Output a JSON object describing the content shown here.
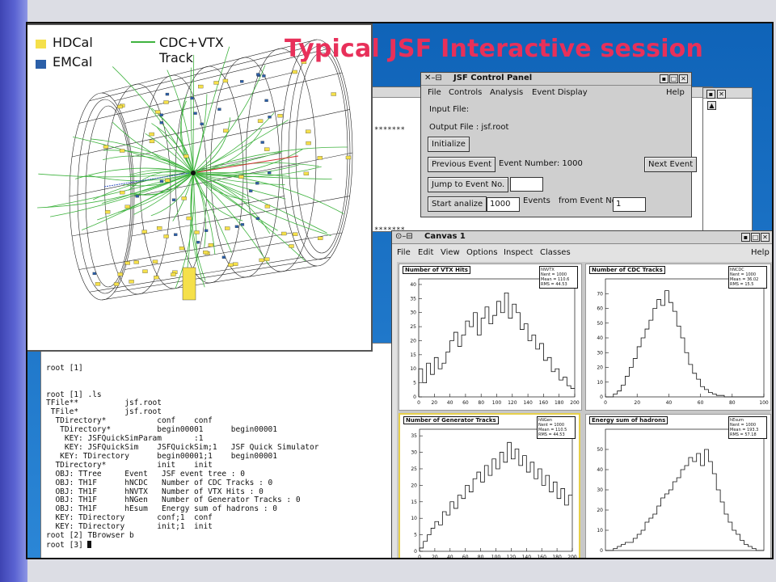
{
  "headline": "Typical JSF Interactive session",
  "event_display": {
    "legend": {
      "hdcal": "HDCal",
      "emcal": "EMCal",
      "track_line1": "CDC+VTX",
      "track_line2": "Track",
      "hdcal_color": "#f5e04a",
      "emcal_color": "#2b5fa8",
      "track_color": "#3fb33f"
    }
  },
  "bg_xterm": {
    "stars1": "*******",
    "stars2": "*******"
  },
  "control_panel": {
    "title": "JSF Control Panel",
    "menus": [
      "File",
      "Controls",
      "Analysis",
      "Event Display"
    ],
    "help": "Help",
    "input_file": "Input File:",
    "output_file": "Output File :  jsf.root",
    "initialize": "Initialize",
    "previous_event": "Previous Event",
    "event_number": "Event Number: 1000",
    "next_event": "Next Event",
    "jump_to": "Jump to Event No.",
    "jump_value": "",
    "start_analize": "Start analize",
    "events_value": "1000",
    "events_label": "Events",
    "from_label": "from Event No.",
    "from_value": "1"
  },
  "terminal": {
    "lines": [
      "root [1] .ls",
      "TFile**          jsf.root",
      " TFile*          jsf.root",
      "  TDirectory*           conf    conf",
      "   TDirectory*          begin00001      begin00001",
      "    KEY: JSFQuickSimParam       :1",
      "    KEY: JSFQuickSim    JSFQuickSim;1   JSF Quick Simulator",
      "   KEY: TDirectory      begin00001;1    begin00001",
      "  TDirectory*           init    init",
      "  OBJ: TTree     Event   JSF event tree : 0",
      "  OBJ: TH1F      hNCDC   Number of CDC Tracks : 0",
      "  OBJ: TH1F      hNVTX   Number of VTX Hits : 0",
      "  OBJ: TH1F      hNGen   Number of Generator Tracks : 0",
      "  OBJ: TH1F      hEsum   Energy sum of hadrons : 0",
      "  KEY: TDirectory       conf;1  conf",
      "  KEY: TDirectory       init;1  init",
      "root [2] TBrowser b",
      "root [3] "
    ],
    "top_fragment": "root [1]"
  },
  "canvas": {
    "title": "Canvas 1",
    "menus": [
      "File",
      "Edit",
      "View",
      "Options",
      "Inspect",
      "Classes"
    ],
    "help": "Help",
    "pads": [
      {
        "title": "Number of VTX Hits",
        "stat_name": "hNVTX",
        "stats": [
          "Nent = 1000",
          "Mean = 110.6",
          "RMS = 44.53"
        ]
      },
      {
        "title": "Number of CDC Tracks",
        "stat_name": "hNCDC",
        "stats": [
          "Nent = 1000",
          "Mean = 36.02",
          "RMS = 15.5"
        ]
      },
      {
        "title": "Number of Generator Tracks",
        "stat_name": "hNGen",
        "stats": [
          "Nent = 1000",
          "Mean = 110.5",
          "RMS = 44.53"
        ]
      },
      {
        "title": "Energy sum of hadrons",
        "stat_name": "hEsum",
        "stats": [
          "Nent = 1000",
          "Mean = 193.3",
          "RMS = 57.18"
        ]
      }
    ]
  },
  "chart_data": [
    {
      "type": "bar",
      "title": "Number of VTX Hits",
      "xlim": [
        0,
        200
      ],
      "ylim": [
        0,
        42
      ],
      "xticks": [
        0,
        20,
        40,
        60,
        80,
        100,
        120,
        140,
        160,
        180,
        200
      ],
      "yticks": [
        0,
        5,
        10,
        15,
        20,
        25,
        30,
        35,
        40
      ],
      "bin_width": 5,
      "values": [
        10,
        5,
        12,
        8,
        14,
        10,
        12,
        16,
        20,
        23,
        18,
        22,
        27,
        25,
        30,
        22,
        28,
        32,
        26,
        29,
        34,
        30,
        37,
        28,
        33,
        30,
        24,
        26,
        20,
        22,
        17,
        19,
        13,
        14,
        9,
        10,
        6,
        7,
        4,
        3
      ]
    },
    {
      "type": "bar",
      "title": "Number of CDC Tracks",
      "xlim": [
        0,
        100
      ],
      "ylim": [
        0,
        80
      ],
      "xticks": [
        0,
        20,
        40,
        60,
        80,
        100
      ],
      "yticks": [
        0,
        10,
        20,
        30,
        40,
        50,
        60,
        70
      ],
      "bin_width": 2.5,
      "values": [
        0,
        0,
        2,
        4,
        8,
        14,
        20,
        26,
        34,
        40,
        46,
        52,
        60,
        66,
        62,
        72,
        64,
        58,
        48,
        40,
        30,
        22,
        16,
        12,
        7,
        5,
        3,
        2,
        1,
        1,
        0,
        0,
        0,
        0,
        0,
        0,
        0,
        0,
        0,
        0
      ]
    },
    {
      "type": "bar",
      "title": "Number of Generator Tracks",
      "xlim": [
        0,
        200
      ],
      "ylim": [
        0,
        37
      ],
      "xticks": [
        0,
        20,
        40,
        60,
        80,
        100,
        120,
        140,
        160,
        180,
        200
      ],
      "yticks": [
        0,
        5,
        10,
        15,
        20,
        25,
        30,
        35
      ],
      "bin_width": 5,
      "values": [
        1,
        3,
        5,
        7,
        9,
        8,
        12,
        11,
        15,
        13,
        17,
        16,
        20,
        18,
        22,
        24,
        21,
        26,
        23,
        28,
        25,
        30,
        27,
        33,
        28,
        31,
        26,
        29,
        24,
        27,
        22,
        25,
        20,
        23,
        18,
        21,
        16,
        19,
        14,
        17
      ]
    },
    {
      "type": "bar",
      "title": "Energy sum of hadrons",
      "xlim": [
        0,
        400
      ],
      "ylim": [
        0,
        60
      ],
      "yticks": [
        0,
        10,
        20,
        30,
        40,
        50
      ],
      "bin_width": 10,
      "values": [
        0,
        0,
        1,
        2,
        3,
        4,
        4,
        6,
        8,
        10,
        14,
        16,
        18,
        22,
        26,
        28,
        30,
        34,
        36,
        40,
        42,
        46,
        44,
        48,
        42,
        50,
        44,
        38,
        30,
        24,
        18,
        14,
        10,
        8,
        5,
        3,
        2,
        1,
        0,
        0
      ]
    }
  ]
}
